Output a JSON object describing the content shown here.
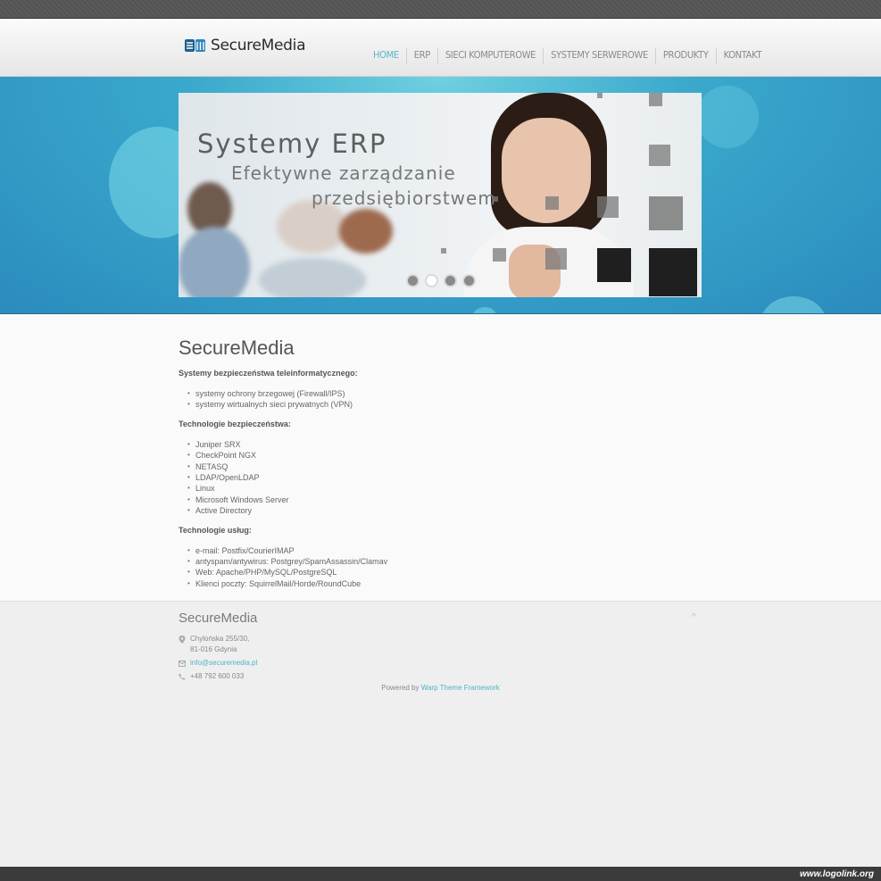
{
  "brand": {
    "name": "SecureMedia"
  },
  "nav": {
    "items": [
      {
        "label": "HOME",
        "active": true
      },
      {
        "label": "ERP",
        "active": false
      },
      {
        "label": "SIECI KOMPUTEROWE",
        "active": false
      },
      {
        "label": "SYSTEMY SERWEROWE",
        "active": false
      },
      {
        "label": "PRODUKTY",
        "active": false
      },
      {
        "label": "KONTAKT",
        "active": false
      }
    ]
  },
  "slider": {
    "title": "Systemy ERP",
    "subtitle_line1": "Efektywne zarządzanie",
    "subtitle_line2": "przedsiębiorstwem",
    "dot_count": 4,
    "active_dot": 1
  },
  "content": {
    "heading": "SecureMedia",
    "sections": [
      {
        "title": "Systemy bezpieczeństwa teleinformatycznego:",
        "items": [
          "systemy ochrony brzegowej (Firewall/IPS)",
          "systemy wirtualnych sieci prywatnych (VPN)"
        ]
      },
      {
        "title": "Technologie bezpieczeństwa:",
        "items": [
          "Juniper SRX",
          "CheckPoint NGX",
          "NETASQ",
          "LDAP/OpenLDAP",
          "Linux",
          "Microsoft Windows Server",
          "Active Directory"
        ]
      },
      {
        "title": "Technologie usług:",
        "items": [
          "e-mail: Postfix/CourierIMAP",
          "antyspam/antywirus: Postgrey/SpamAssassin/Clamav",
          "Web: Apache/PHP/MySQL/PostgreSQL",
          "Klienci poczty: SquirrelMail/Horde/RoundCube"
        ]
      }
    ]
  },
  "footer": {
    "title": "SecureMedia",
    "address_line1": "Chylońska 255/30,",
    "address_line2": "81-016 Gdynia",
    "email": "info@securemedia.pl",
    "phone": "+48 792 600 033",
    "powered_prefix": "Powered by",
    "powered_link": "Warp Theme Framework",
    "to_top": "^"
  },
  "watermark": "www.logolink.org",
  "colors": {
    "accent": "#5cb6c8",
    "hero": "#2b8bbd",
    "link": "#4fb3c6"
  }
}
